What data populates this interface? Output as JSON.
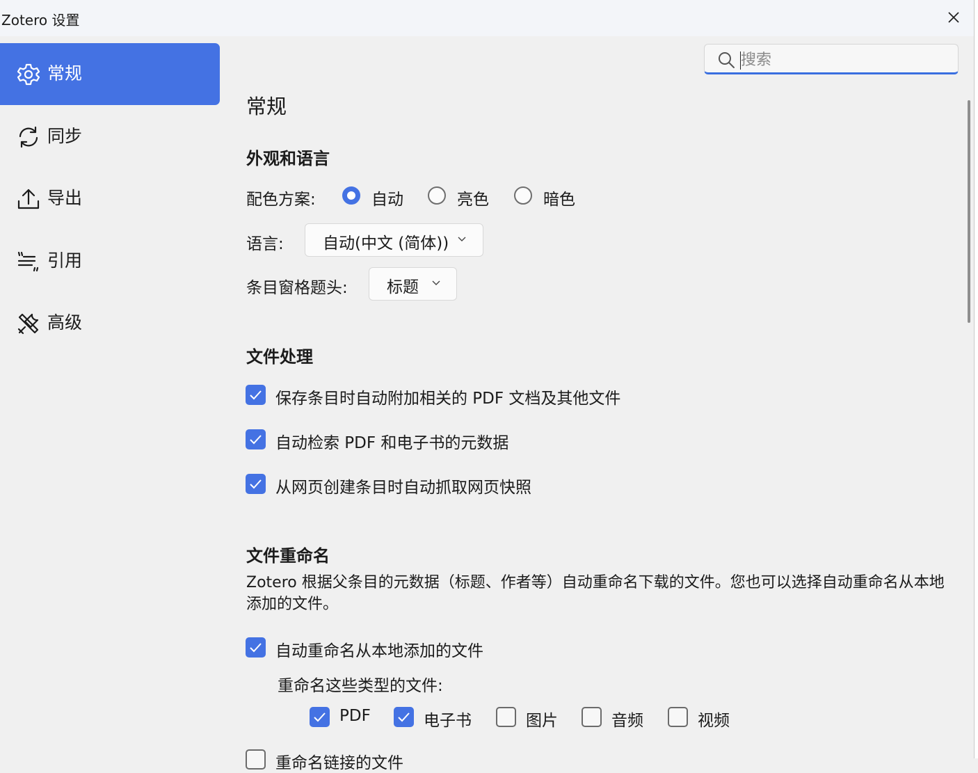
{
  "window": {
    "title": "Zotero 设置"
  },
  "sidebar": {
    "items": [
      {
        "label": "常规",
        "icon": "gear-icon",
        "active": true
      },
      {
        "label": "同步",
        "icon": "sync-icon"
      },
      {
        "label": "导出",
        "icon": "export-icon"
      },
      {
        "label": "引用",
        "icon": "cite-icon"
      },
      {
        "label": "高级",
        "icon": "tools-icon"
      }
    ]
  },
  "search": {
    "placeholder": "搜索",
    "value": ""
  },
  "page": {
    "title": "常规"
  },
  "appearance": {
    "heading": "外观和语言",
    "color_scheme_label": "配色方案:",
    "color_scheme_options": [
      "自动",
      "亮色",
      "暗色"
    ],
    "color_scheme_selected": "自动",
    "language_label": "语言:",
    "language_value": "自动(中文 (简体))",
    "item_pane_header_label": "条目窗格题头:",
    "item_pane_header_value": "标题"
  },
  "file_handling": {
    "heading": "文件处理",
    "options": [
      {
        "label": "保存条目时自动附加相关的 PDF 文档及其他文件",
        "checked": true
      },
      {
        "label": "自动检索 PDF 和电子书的元数据",
        "checked": true
      },
      {
        "label": "从网页创建条目时自动抓取网页快照",
        "checked": true
      }
    ]
  },
  "file_renaming": {
    "heading": "文件重命名",
    "description": "Zotero 根据父条目的元数据（标题、作者等）自动重命名下载的文件。您也可以选择自动重命名从本地添加的文件。",
    "auto_rename_label": "自动重命名从本地添加的文件",
    "auto_rename_checked": true,
    "types_label": "重命名这些类型的文件:",
    "types": [
      {
        "label": "PDF",
        "checked": true
      },
      {
        "label": "电子书",
        "checked": true
      },
      {
        "label": "图片",
        "checked": false
      },
      {
        "label": "音频",
        "checked": false
      },
      {
        "label": "视频",
        "checked": false
      }
    ],
    "rename_linked_label": "重命名链接的文件",
    "rename_linked_checked": false
  },
  "colors": {
    "accent": "#4472e3",
    "background": "#f0f0f0"
  }
}
